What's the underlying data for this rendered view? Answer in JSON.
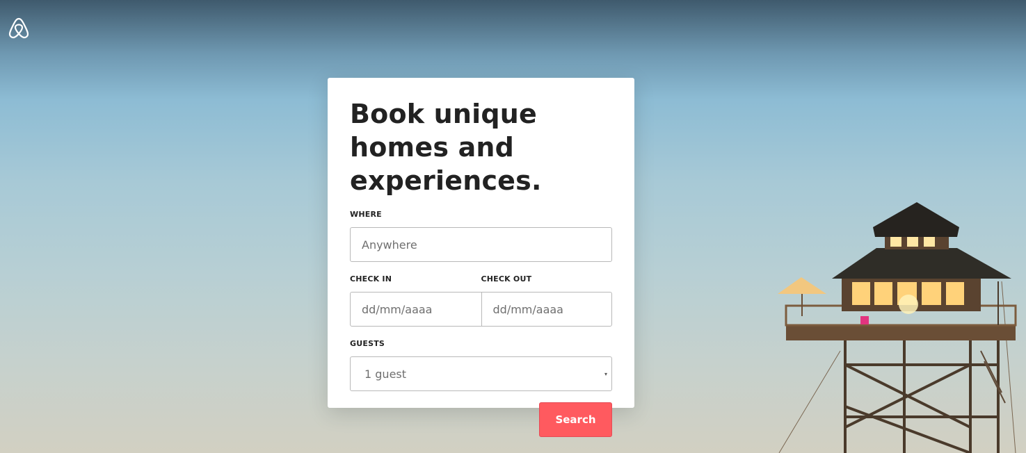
{
  "brand": {
    "logo_icon": "airbnb-belo-icon",
    "logo_color": "#ffffff"
  },
  "search_form": {
    "title": "Book unique homes and experiences.",
    "where": {
      "label": "WHERE",
      "placeholder": "Anywhere"
    },
    "check_in": {
      "label": "CHECK IN",
      "placeholder": "dd/mm/aaaa"
    },
    "check_out": {
      "label": "CHECK OUT",
      "placeholder": "dd/mm/aaaa"
    },
    "guests": {
      "label": "GUESTS",
      "selected": "1 guest",
      "caret": "▾"
    },
    "search_button": {
      "label": "Search",
      "color": "#ff5a5f"
    }
  },
  "hero": {
    "image_subject": "lookout-tower-house"
  }
}
